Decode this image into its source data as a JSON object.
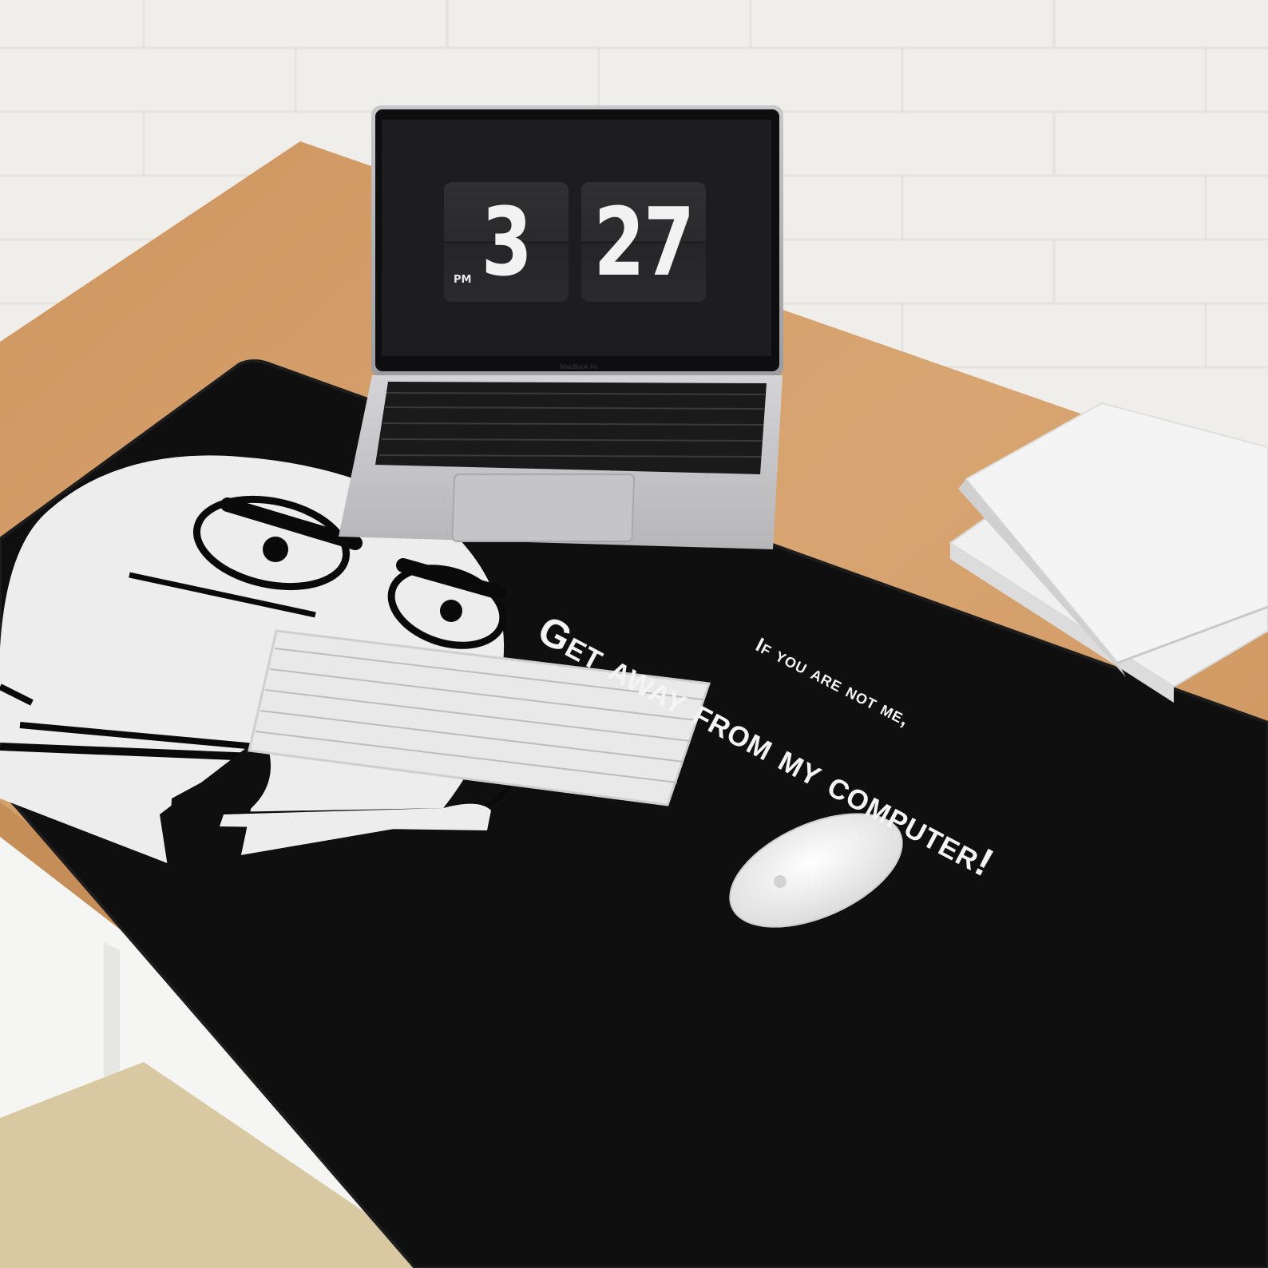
{
  "laptop": {
    "clock_hours": "3",
    "clock_minutes": "27",
    "clock_ampm": "PM",
    "brand": "MacBook Air"
  },
  "mat": {
    "line1": "If you are not me,",
    "line2": "Get away from my computer!",
    "colors": {
      "mat": "#0f0f0f",
      "print": "#ededed"
    }
  },
  "colors": {
    "wall": "#efeeea",
    "desk": "#d29a62",
    "desk_frame": "#f4f4f2"
  }
}
